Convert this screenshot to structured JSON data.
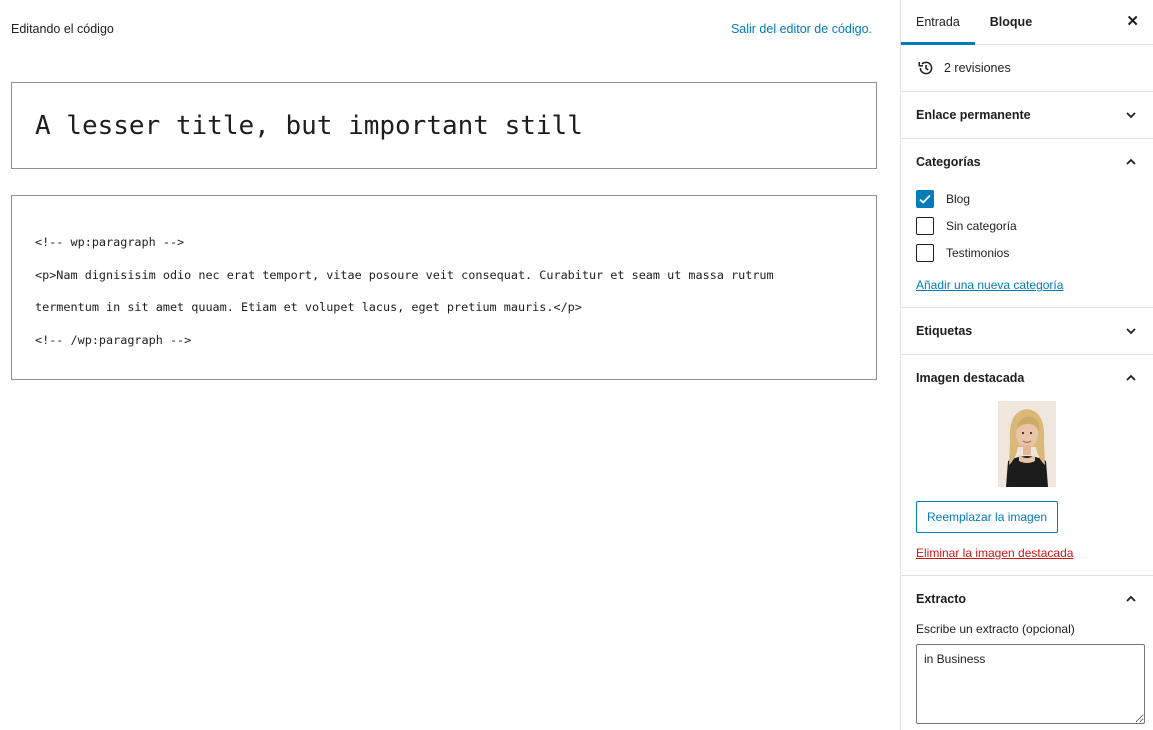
{
  "editor": {
    "editing_label": "Editando el código",
    "exit_link": "Salir del editor de código.",
    "title": "A lesser title, but important still",
    "code_lines": [
      "<!-- wp:paragraph -->",
      "<p>Nam dignisisim odio nec erat temport, vitae posoure veit consequat. Curabitur et seam ut massa rutrum",
      "termentum in sit amet quuam. Etiam et volupet lacus, eget pretium mauris.</p>",
      "<!-- /wp:paragraph -->"
    ]
  },
  "sidebar": {
    "tabs": [
      {
        "label": "Entrada",
        "active": true
      },
      {
        "label": "Bloque",
        "active": false
      }
    ],
    "close_glyph": "✕",
    "revisions": "2 revisiones",
    "panels": {
      "permalink": "Enlace permanente",
      "categories": "Categorías",
      "tags": "Etiquetas",
      "featured_image": "Imagen destacada",
      "excerpt": "Extracto"
    },
    "categories": [
      {
        "label": "Blog",
        "checked": true
      },
      {
        "label": "Sin categoría",
        "checked": false
      },
      {
        "label": "Testimonios",
        "checked": false
      }
    ],
    "add_category": "Añadir una nueva categoría",
    "replace_image": "Reemplazar la imagen",
    "remove_image": "Eliminar la imagen destacada",
    "excerpt_label": "Escribe un extracto (opcional)",
    "excerpt_value": "in Business"
  },
  "colors": {
    "accent": "#007cba",
    "danger": "#cc1818",
    "border": "#e0e0e0"
  }
}
